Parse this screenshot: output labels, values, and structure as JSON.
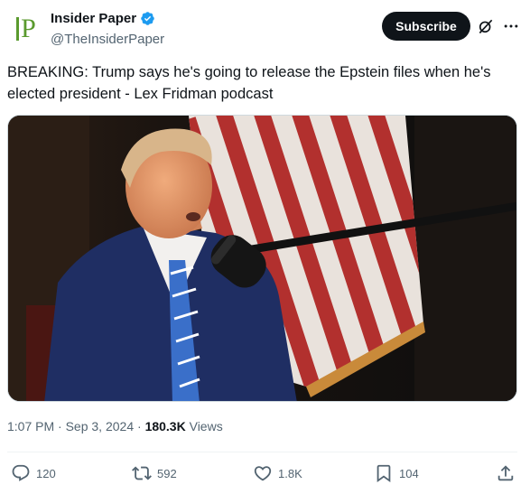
{
  "author": {
    "avatar_text": "P",
    "display_name": "Insider Paper",
    "handle": "@TheInsiderPaper"
  },
  "header": {
    "subscribe_label": "Subscribe"
  },
  "tweet": {
    "text": "BREAKING: Trump says he's going to release the Epstein files when he's elected president - Lex Fridman podcast"
  },
  "meta": {
    "time": "1:07 PM",
    "date": "Sep 3, 2024",
    "views_count": "180.3K",
    "views_label": "Views",
    "separator": "·"
  },
  "actions": {
    "replies": "120",
    "reposts": "592",
    "likes": "1.8K",
    "bookmarks": "104"
  },
  "colors": {
    "brand_green": "#5a9a2e",
    "verified_blue": "#1d9bf0",
    "text_primary": "#0f1419",
    "text_secondary": "#536471"
  }
}
